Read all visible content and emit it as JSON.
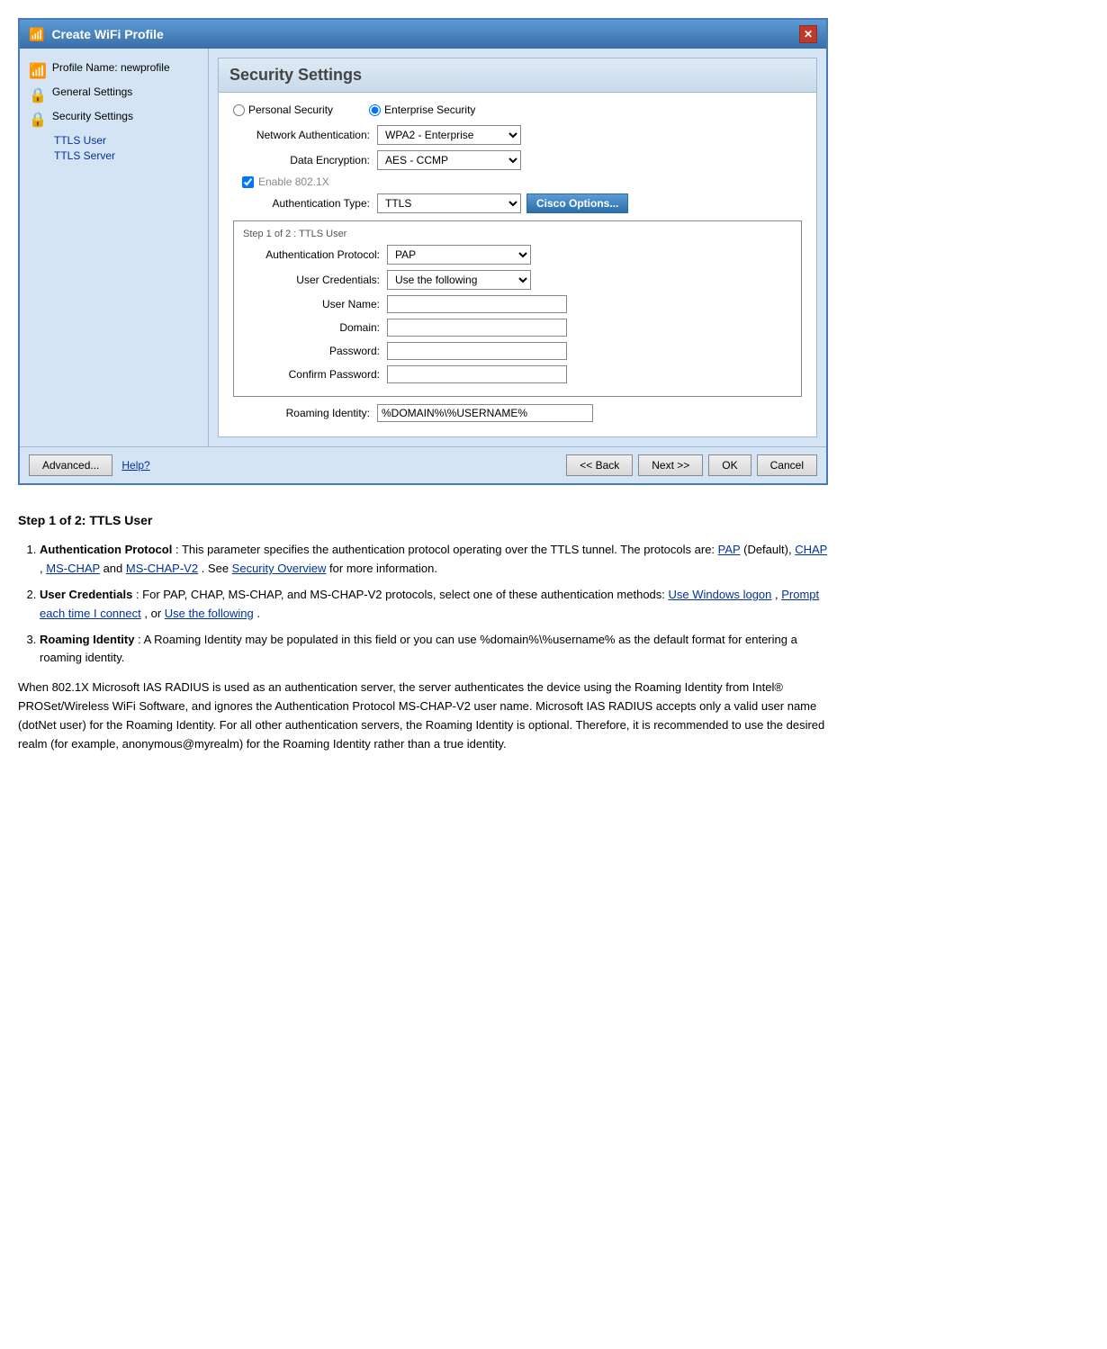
{
  "dialog": {
    "title": "Create WiFi Profile",
    "close_button": "✕",
    "left_panel": {
      "items": [
        {
          "icon": "wifi",
          "label": "Profile Name: newprofile"
        },
        {
          "icon": "lock",
          "label": "General Settings"
        },
        {
          "icon": "lock",
          "label": "Security Settings",
          "sub_items": [
            "TTLS User",
            "TTLS Server"
          ]
        }
      ]
    },
    "right_panel": {
      "title": "Security Settings",
      "personal_security_label": "Personal Security",
      "enterprise_security_label": "Enterprise Security",
      "network_auth_label": "Network Authentication:",
      "network_auth_value": "WPA2 - Enterprise",
      "data_encryption_label": "Data Encryption:",
      "data_encryption_value": "AES - CCMP",
      "enable_8021x_label": "Enable 802.1X",
      "auth_type_label": "Authentication Type:",
      "auth_type_value": "TTLS",
      "cisco_options_label": "Cisco Options...",
      "step_label": "Step 1 of 2 : TTLS User",
      "auth_protocol_label": "Authentication Protocol:",
      "auth_protocol_value": "PAP",
      "user_credentials_label": "User Credentials:",
      "user_credentials_value": "Use the following",
      "username_label": "User Name:",
      "domain_label": "Domain:",
      "password_label": "Password:",
      "confirm_password_label": "Confirm Password:",
      "roaming_identity_label": "Roaming Identity:",
      "roaming_identity_value": "%DOMAIN%\\%USERNAME%"
    },
    "footer": {
      "advanced_label": "Advanced...",
      "help_label": "Help?",
      "back_label": "<< Back",
      "next_label": "Next >>",
      "ok_label": "OK",
      "cancel_label": "Cancel"
    }
  },
  "description": {
    "heading": "Step 1 of 2: TTLS User",
    "items": [
      {
        "term": "Authentication Protocol",
        "text": ": This parameter specifies the authentication protocol operating over the TTLS tunnel. The protocols are: ",
        "links": [
          {
            "label": "PAP",
            "href": "#"
          },
          {
            "label": "CHAP",
            "href": "#"
          },
          {
            "label": "MS-CHAP",
            "href": "#"
          },
          {
            "label": "MS-CHAP-V2",
            "href": "#"
          },
          {
            "label": "Security Overview",
            "href": "#"
          }
        ],
        "after_links": " (Default), ",
        "suffix": " for more information."
      },
      {
        "term": "User Credentials",
        "text": ": For PAP, CHAP, MS-CHAP, and MS-CHAP-V2 protocols, select one of these authentication methods: ",
        "links": [
          {
            "label": "Use Windows logon",
            "href": "#"
          },
          {
            "label": "Prompt each time I connect",
            "href": "#"
          },
          {
            "label": "Use the following",
            "href": "#"
          }
        ],
        "suffix": "."
      },
      {
        "term": "Roaming Identity",
        "text": ": A Roaming Identity may be populated in this field or you can use %domain%\\%username% as the default format for entering a roaming identity."
      }
    ],
    "paragraph": "When 802.1X Microsoft IAS RADIUS is used as an authentication server, the server authenticates the device using the Roaming Identity from Intel® PROSet/Wireless WiFi Software, and ignores the Authentication Protocol MS-CHAP-V2 user name. Microsoft IAS RADIUS accepts only a valid user name (dotNet user) for the Roaming Identity. For all other authentication servers, the Roaming Identity is optional. Therefore, it is recommended to use the desired realm (for example, anonymous@myrealm) for the Roaming Identity rather than a true identity."
  }
}
